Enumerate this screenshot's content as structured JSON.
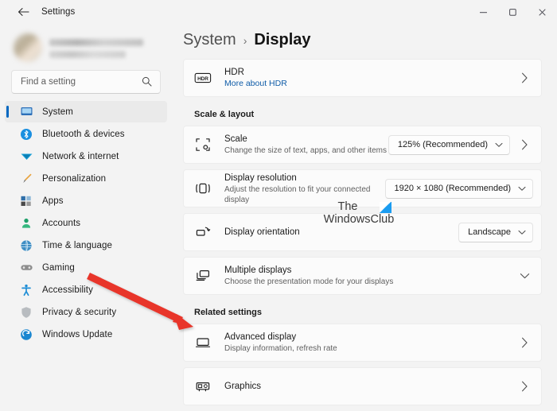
{
  "window": {
    "title": "Settings",
    "back_icon": "back-arrow-icon",
    "controls": {
      "minimize": "minimize-icon",
      "maximize": "maximize-icon",
      "close": "close-icon"
    }
  },
  "sidebar": {
    "profile": {
      "avatar": "user-avatar",
      "name_redacted": "",
      "email_redacted": ""
    },
    "search": {
      "placeholder": "Find a setting",
      "value": "",
      "icon": "search-icon"
    },
    "items": [
      {
        "label": "System",
        "icon": "monitor-icon",
        "selected": true
      },
      {
        "label": "Bluetooth & devices",
        "icon": "bluetooth-icon",
        "selected": false
      },
      {
        "label": "Network & internet",
        "icon": "network-icon",
        "selected": false
      },
      {
        "label": "Personalization",
        "icon": "paintbrush-icon",
        "selected": false
      },
      {
        "label": "Apps",
        "icon": "apps-icon",
        "selected": false
      },
      {
        "label": "Accounts",
        "icon": "person-icon",
        "selected": false
      },
      {
        "label": "Time & language",
        "icon": "clock-globe-icon",
        "selected": false
      },
      {
        "label": "Gaming",
        "icon": "gamepad-icon",
        "selected": false
      },
      {
        "label": "Accessibility",
        "icon": "accessibility-icon",
        "selected": false
      },
      {
        "label": "Privacy & security",
        "icon": "shield-icon",
        "selected": false
      },
      {
        "label": "Windows Update",
        "icon": "update-icon",
        "selected": false
      }
    ]
  },
  "breadcrumb": {
    "parent": "System",
    "separator": "›",
    "current": "Display"
  },
  "main": {
    "hdr_card": {
      "title": "HDR",
      "link": "More about HDR",
      "icon": "hdr-icon",
      "chevron": "chevron-right-icon"
    },
    "sections": [
      {
        "heading": "Scale & layout",
        "cards": [
          {
            "title": "Scale",
            "sub": "Change the size of text, apps, and other items",
            "icon": "scale-icon",
            "dropdown_value": "125% (Recommended)",
            "chevron": "chevron-right-icon"
          },
          {
            "title": "Display resolution",
            "sub": "Adjust the resolution to fit your connected display",
            "icon": "resolution-icon",
            "dropdown_value": "1920 × 1080 (Recommended)"
          },
          {
            "title": "Display orientation",
            "sub": "",
            "icon": "orientation-icon",
            "dropdown_value": "Landscape"
          },
          {
            "title": "Multiple displays",
            "sub": "Choose the presentation mode for your displays",
            "icon": "multiple-displays-icon",
            "expander": "chevron-down-icon"
          }
        ]
      },
      {
        "heading": "Related settings",
        "cards": [
          {
            "title": "Advanced display",
            "sub": "Display information, refresh rate",
            "icon": "advanced-display-icon",
            "chevron": "chevron-right-icon"
          },
          {
            "title": "Graphics",
            "sub": "",
            "icon": "graphics-card-icon",
            "chevron": "chevron-right-icon"
          }
        ]
      }
    ]
  },
  "watermark": {
    "line1": "The",
    "line2": "WindowsClub",
    "logo": "windowsclub-logo"
  },
  "annotation": {
    "type": "red-arrow",
    "color": "#e8352a",
    "points_to": "Advanced display"
  },
  "colors": {
    "accent": "#0067c0",
    "link": "#0f5ca8",
    "page_bg": "#f3f3f3",
    "card_bg": "#fbfbfb",
    "annotation_red": "#e8352a"
  }
}
